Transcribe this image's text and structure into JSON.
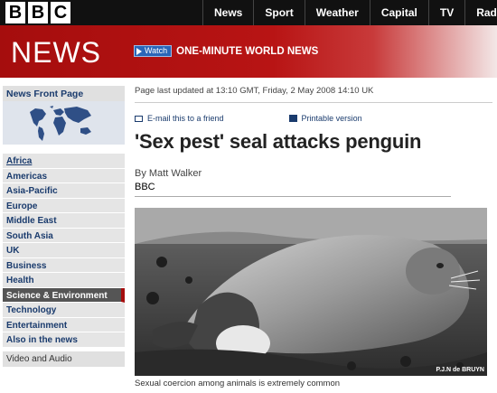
{
  "masthead": {
    "logo_letters": [
      "B",
      "B",
      "C"
    ],
    "nav": [
      "News",
      "Sport",
      "Weather",
      "Capital",
      "TV",
      "Radio"
    ]
  },
  "banner": {
    "title": "NEWS",
    "watch_label": "Watch",
    "promo": "ONE-MINUTE WORLD NEWS"
  },
  "sidebar": {
    "front_page": "News Front Page",
    "map_icon": "world-map-icon",
    "items": [
      "Africa",
      "Americas",
      "Asia-Pacific",
      "Europe",
      "Middle East",
      "South Asia",
      "UK",
      "Business",
      "Health",
      "Science & Environment",
      "Technology",
      "Entertainment",
      "Also in the news"
    ],
    "active_item": "Science & Environment",
    "video_audio": "Video and Audio"
  },
  "article": {
    "updated": "Page last updated at 13:10 GMT, Friday, 2 May 2008 14:10 UK",
    "email_label": "E-mail this to a friend",
    "print_label": "Printable version",
    "headline": "'Sex pest' seal attacks penguin",
    "byline": "By Matt Walker",
    "source": "BBC",
    "photo_credit": "P.J.N de BRUYN",
    "caption": "Sexual coercion among animals is extremely common"
  },
  "colors": {
    "banner_red": "#a50d0d",
    "link_blue": "#1a3b6d",
    "active_bg": "#555555"
  }
}
